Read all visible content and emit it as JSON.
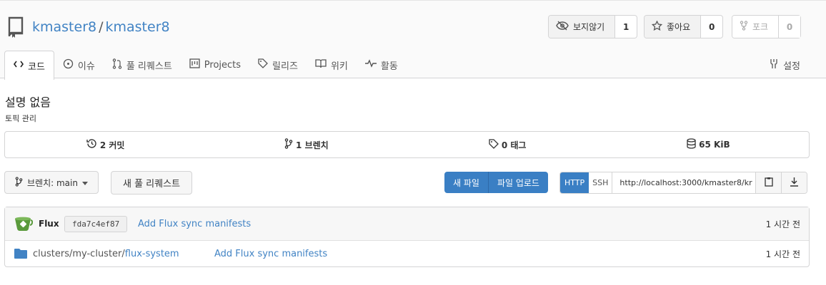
{
  "repo": {
    "owner": "kmaster8",
    "separator": "/",
    "name": "kmaster8"
  },
  "actions": {
    "watch": {
      "label": "보지않기",
      "count": "1"
    },
    "star": {
      "label": "좋아요",
      "count": "0"
    },
    "fork": {
      "label": "포크",
      "count": "0"
    }
  },
  "tabs": [
    {
      "label": "코드",
      "icon": "code-icon"
    },
    {
      "label": "이슈",
      "icon": "issue-icon"
    },
    {
      "label": "풀 리퀘스트",
      "icon": "pull-request-icon"
    },
    {
      "label": "Projects",
      "icon": "project-icon"
    },
    {
      "label": "릴리즈",
      "icon": "tag-icon"
    },
    {
      "label": "위키",
      "icon": "book-icon"
    },
    {
      "label": "활동",
      "icon": "pulse-icon"
    }
  ],
  "settings_label": "설정",
  "description": "설명 없음",
  "topics_label": "토픽 관리",
  "stats": {
    "commits": "2 커밋",
    "branches": "1 브렌치",
    "tags": "0 태그",
    "size": "65 KiB"
  },
  "branch_button": "브렌치: main",
  "new_pr_button": "새 풀 리퀘스트",
  "new_file_button": "새 파일",
  "upload_button": "파일 업로드",
  "clone": {
    "http": "HTTP",
    "ssh": "SSH",
    "url": "http://localhost:3000/kmaster8/kr"
  },
  "latest_commit": {
    "author": "Flux",
    "sha": "fda7c4ef87",
    "message": "Add Flux sync manifests",
    "time": "1 시간 전"
  },
  "files": [
    {
      "path_prefix": "clusters/my-cluster/",
      "path_name": "flux-system",
      "message": "Add Flux sync manifests",
      "time": "1 시간 전"
    }
  ],
  "colors": {
    "primary": "#3a7fc4",
    "link": "#4183c4",
    "avatar": "#5a9a3c"
  }
}
